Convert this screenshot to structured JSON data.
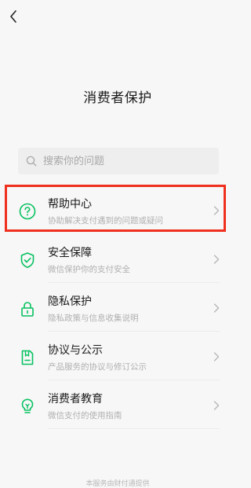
{
  "header": {
    "back_icon": "chevron-left-icon",
    "title": "消费者保护"
  },
  "search": {
    "icon": "search-icon",
    "placeholder": "搜索你的问题"
  },
  "menu": {
    "items": [
      {
        "icon": "question-circle-icon",
        "title": "帮助中心",
        "subtitle": "协助解决支付遇到的问题或疑问",
        "highlighted": true
      },
      {
        "icon": "shield-check-icon",
        "title": "安全保障",
        "subtitle": "微信保护你的支付安全"
      },
      {
        "icon": "lock-icon",
        "title": "隐私保护",
        "subtitle": "隐私政策与信息收集说明"
      },
      {
        "icon": "document-icon",
        "title": "协议与公示",
        "subtitle": "产品服务的协议与修订公示"
      },
      {
        "icon": "lightbulb-icon",
        "title": "消费者教育",
        "subtitle": "微信支付的使用指南"
      }
    ]
  },
  "footer": {
    "text": "本服务由财付通提供"
  },
  "colors": {
    "accent_green": "#07c160",
    "highlight_red": "#f0301e",
    "background": "#f7f7f7"
  }
}
